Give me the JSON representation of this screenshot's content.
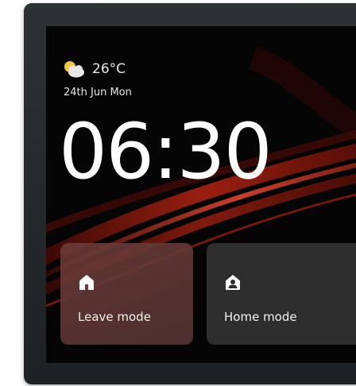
{
  "weather": {
    "icon": "partly-cloudy-icon",
    "temperature": "26°C"
  },
  "date": "24th Jun Mon",
  "clock": "06:30",
  "modes": [
    {
      "label": "Leave mode",
      "icon": "house-icon"
    },
    {
      "label": "Home mode",
      "icon": "home-person-icon"
    }
  ],
  "colors": {
    "accent_red": "#c8301f",
    "screen_bg": "#050505",
    "bezel": "#262b2e"
  }
}
